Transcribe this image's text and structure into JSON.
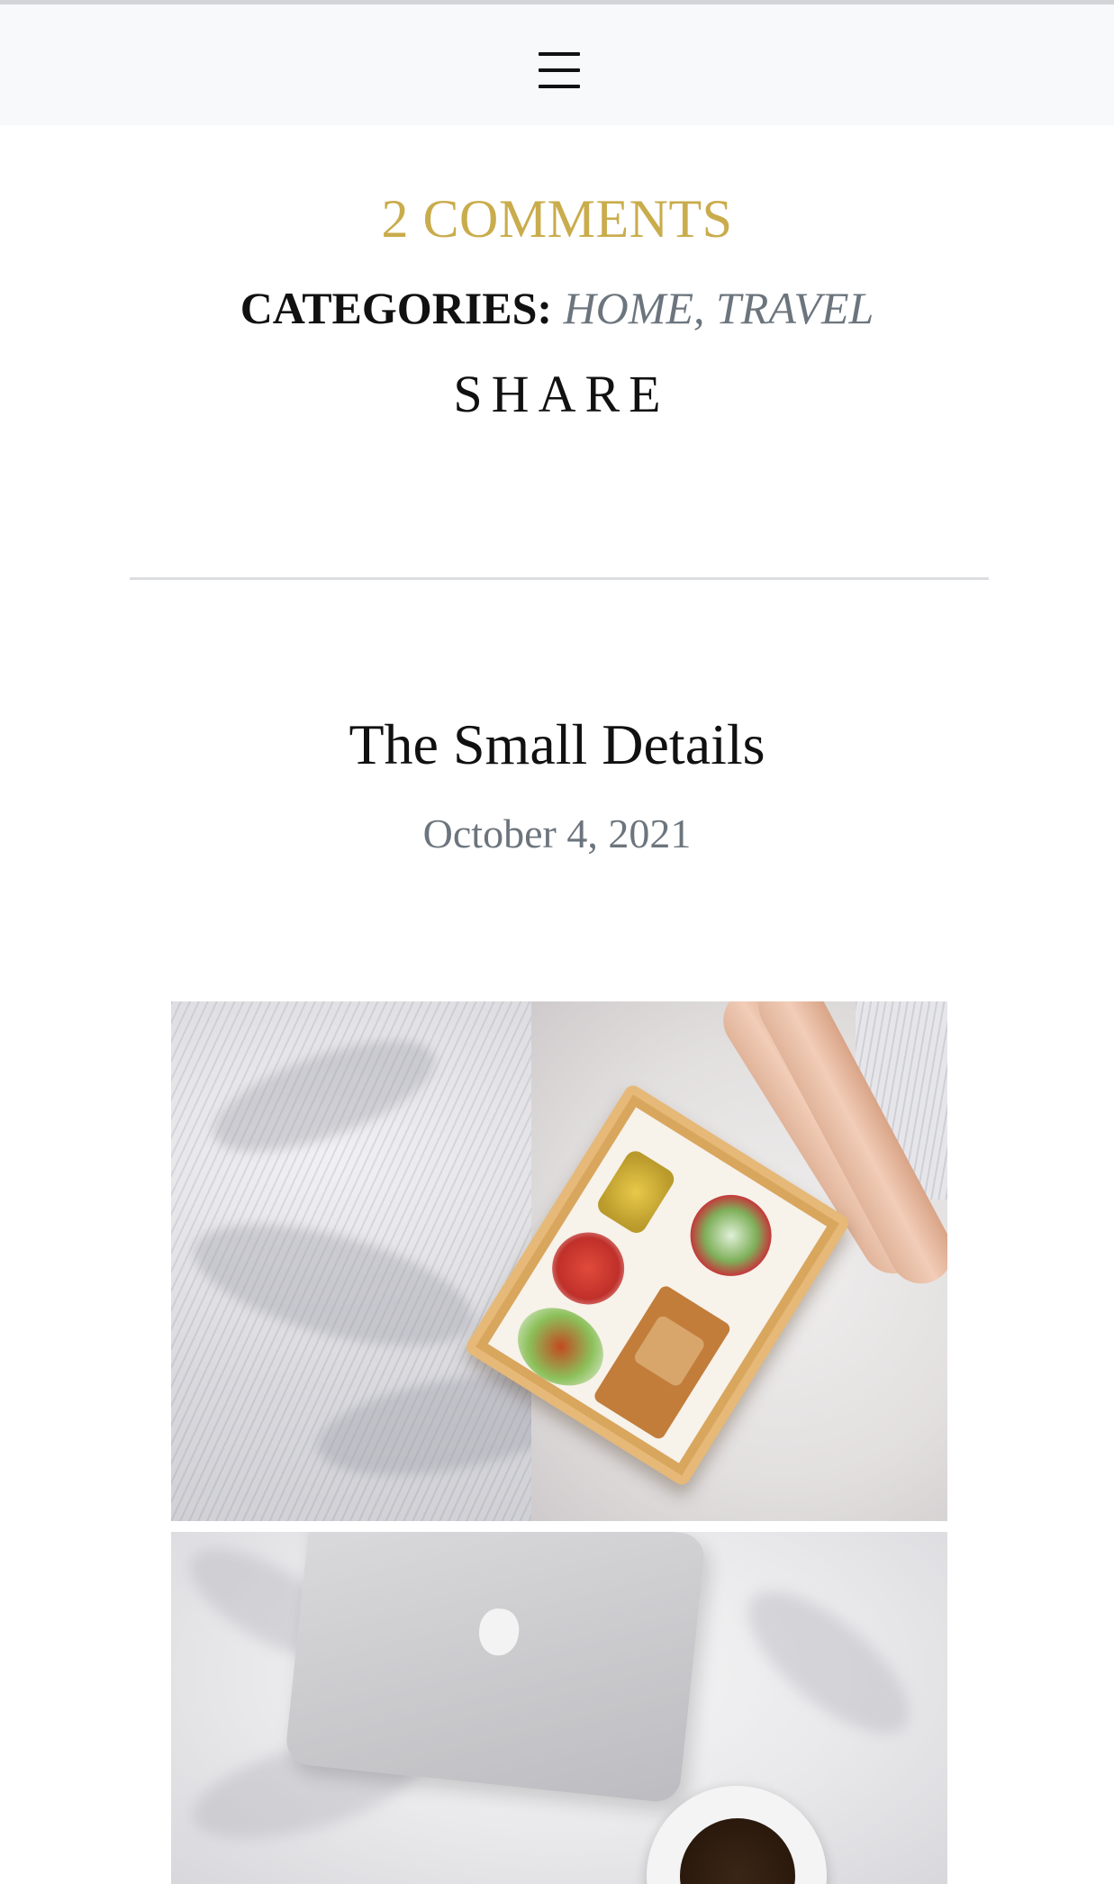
{
  "header": {
    "menu_icon": "hamburger-menu-icon"
  },
  "post_meta": {
    "comments_label": "2 COMMENTS",
    "categories_label": "CATEGORIES:",
    "categories": [
      "HOME",
      "TRAVEL"
    ],
    "category_separator": ", ",
    "share_label": "SHARE"
  },
  "post": {
    "title": "The Small Details",
    "date": "October 4, 2021",
    "images": [
      {
        "alt": "Breakfast tray on a bed with legs"
      },
      {
        "alt": "Laptop and coffee cup on a white bed"
      }
    ]
  },
  "colors": {
    "accent_gold": "#c9ac4c",
    "muted_gray": "#6c757d",
    "header_bg": "#f8f9fa",
    "text": "#111111"
  }
}
